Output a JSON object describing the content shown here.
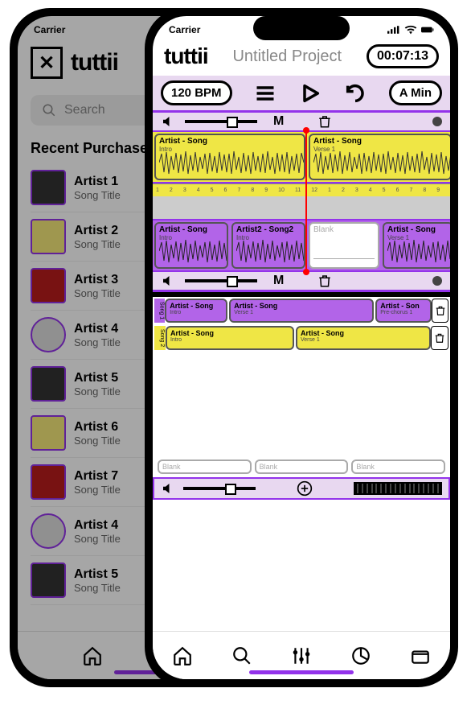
{
  "status": {
    "carrier": "Carrier"
  },
  "back": {
    "logo": "tuttii",
    "search_placeholder": "Search",
    "section_title": "Recent Purchases",
    "songs": [
      {
        "artist": "Artist 1",
        "title": "Song Title"
      },
      {
        "artist": "Artist 2",
        "title": "Song Title"
      },
      {
        "artist": "Artist 3",
        "title": "Song Title"
      },
      {
        "artist": "Artist 4",
        "title": "Song Title"
      },
      {
        "artist": "Artist 5",
        "title": "Song Title"
      },
      {
        "artist": "Artist 6",
        "title": "Song Title"
      },
      {
        "artist": "Artist 7",
        "title": "Song Title"
      },
      {
        "artist": "Artist 4",
        "title": "Song Title"
      },
      {
        "artist": "Artist 5",
        "title": "Song Title"
      }
    ]
  },
  "front": {
    "logo": "tuttii",
    "project": "Untitled Project",
    "time": "00:07:13",
    "bpm": "120 BPM",
    "key": "A Min",
    "mute": "M",
    "track1": {
      "clip1": {
        "title": "Artist - Song",
        "sub": "Intro"
      },
      "clip2": {
        "title": "Artist - Song",
        "sub": "Verse 1"
      }
    },
    "track2": {
      "clip1": {
        "title": "Artist - Song",
        "sub": "Intro"
      },
      "clip2": {
        "title": "Artist2 - Song2",
        "sub": "Intro"
      },
      "clip3": {
        "title": "Blank",
        "sub": ""
      },
      "clip4": {
        "title": "Artist - Song",
        "sub": "Verse 1"
      }
    },
    "arr": {
      "label1": "Song 1",
      "label2": "Song 2",
      "row1": [
        {
          "title": "Artist - Song",
          "sub": "Intro"
        },
        {
          "title": "Artist - Song",
          "sub": "Verse 1"
        },
        {
          "title": "Artist - Son",
          "sub": "Pre-chorus 1"
        }
      ],
      "row2": [
        {
          "title": "Artist - Song",
          "sub": "Intro"
        },
        {
          "title": "Artist - Song",
          "sub": "Verse 1"
        }
      ],
      "blank": "Blank"
    }
  }
}
